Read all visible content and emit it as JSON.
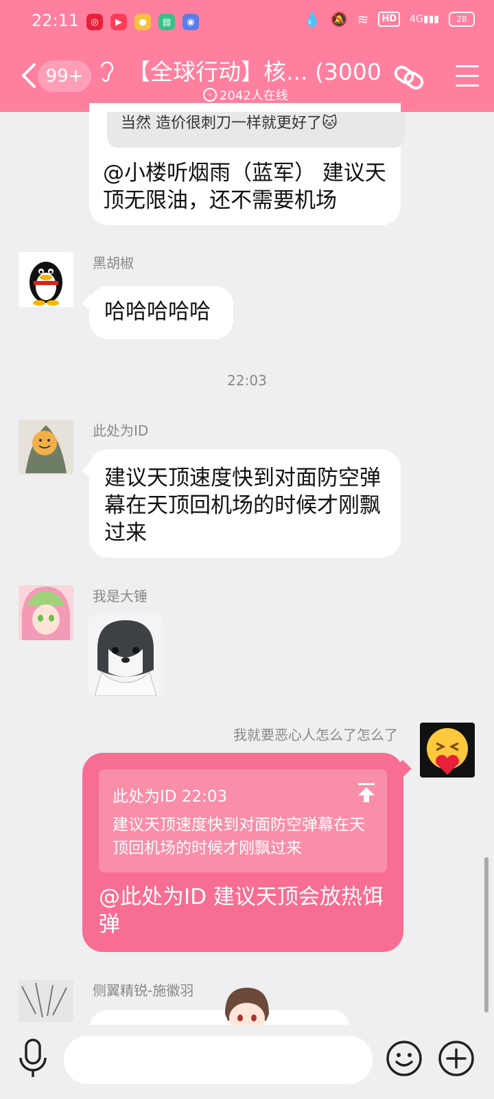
{
  "status_bar": {
    "time": "22:11",
    "network_label": "HD",
    "signal_label": "4G",
    "battery_level": "28"
  },
  "header": {
    "unread_count": "99+",
    "title": "【全球行动】核... (3000)",
    "online_text": "2042人在线",
    "accent_color": "#ff7f9f"
  },
  "messages": {
    "quoted_top": "当然 造价很刺刀一样就更好了🐱",
    "msg0_text": "@小楼听烟雨（蓝军） 建议天顶无限油，还不需要机场",
    "msg1_sender": "黑胡椒",
    "msg1_text": "哈哈哈哈哈",
    "timestamp": "22:03",
    "msg2_sender": "此处为ID",
    "msg2_text": "建议天顶速度快到对面防空弹幕在天顶回机场的时候才刚飘过来",
    "msg3_sender": "我是大锤",
    "msg4_sender": "我就要恶心人怎么了怎么了",
    "msg4_reply_header": "此处为ID 22:03",
    "msg4_reply_body": "建议天顶速度快到对面防空弹幕在天顶回机场的时候才刚飘过来",
    "msg4_text": "@此处为ID 建议天顶会放热饵弹",
    "msg5_sender": "侧翼精锐-施徽羽"
  },
  "input": {
    "placeholder": ""
  }
}
